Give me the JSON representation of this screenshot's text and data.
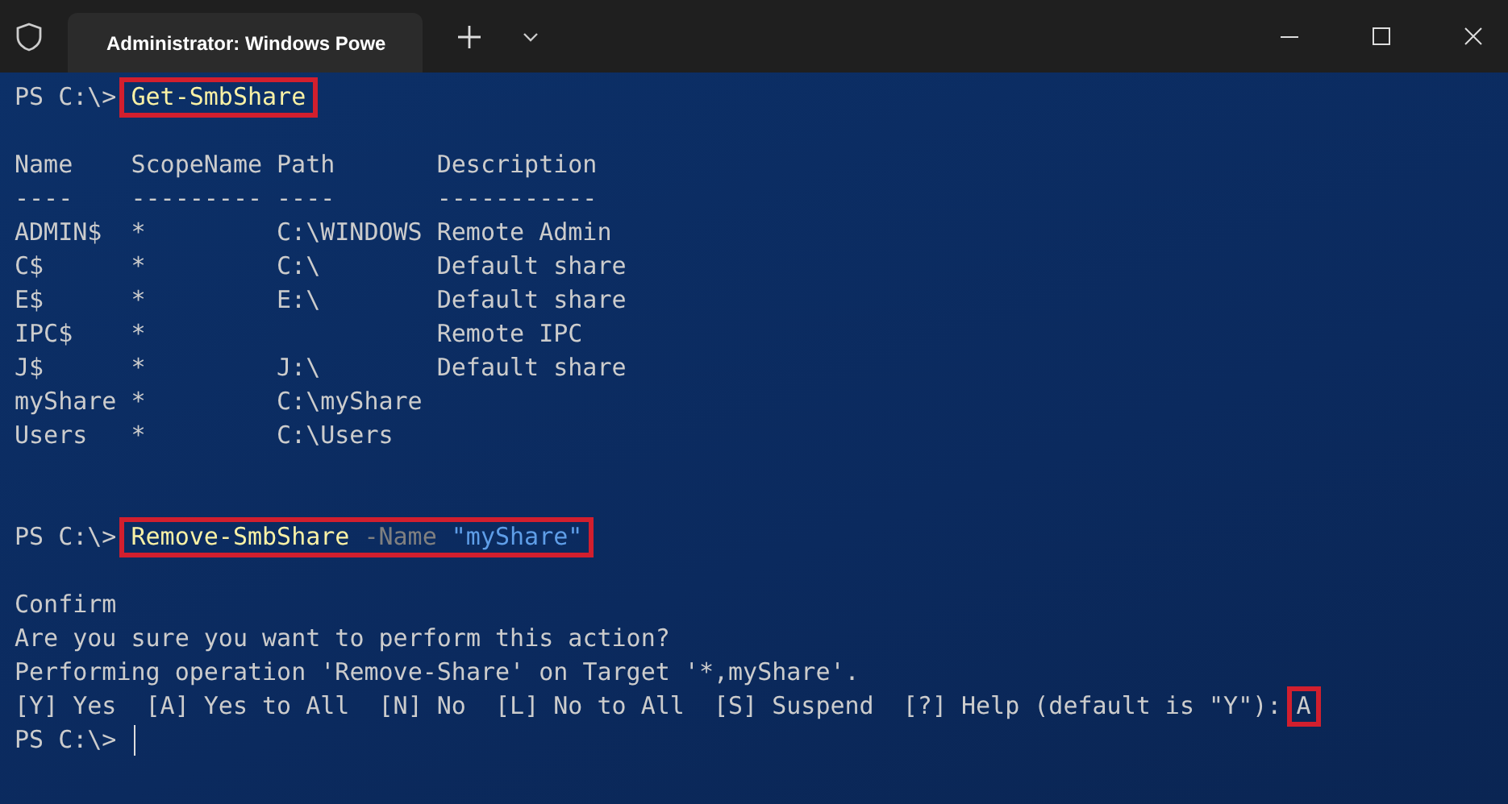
{
  "window": {
    "tab_title": "Administrator: Windows Powe"
  },
  "lines": [
    {
      "kind": "prompt",
      "prompt": "PS C:\\>",
      "segments": [
        {
          "text": "Get-SmbShare",
          "kind": "command"
        }
      ],
      "highlighted": true
    },
    {
      "kind": "blank"
    },
    {
      "kind": "table",
      "columns": [
        "Name",
        "ScopeName",
        "Path",
        "Description"
      ],
      "rules": [
        "----",
        "---------",
        "----",
        "-----------"
      ],
      "rows": [
        [
          "ADMIN$",
          "*",
          "C:\\WINDOWS",
          "Remote Admin"
        ],
        [
          "C$",
          "*",
          "C:\\",
          "Default share"
        ],
        [
          "E$",
          "*",
          "E:\\",
          "Default share"
        ],
        [
          "IPC$",
          "*",
          "",
          "Remote IPC"
        ],
        [
          "J$",
          "*",
          "J:\\",
          "Default share"
        ],
        [
          "myShare",
          "*",
          "C:\\myShare",
          ""
        ],
        [
          "Users",
          "*",
          "C:\\Users",
          ""
        ]
      ]
    },
    {
      "kind": "blank"
    },
    {
      "kind": "blank"
    },
    {
      "kind": "prompt",
      "prompt": "PS C:\\>",
      "segments": [
        {
          "text": "Remove-SmbShare",
          "kind": "command"
        },
        {
          "text": "-Name",
          "kind": "parameter"
        },
        {
          "text": "\"myShare\"",
          "kind": "string"
        }
      ],
      "highlighted": true
    },
    {
      "kind": "blank"
    },
    {
      "kind": "text",
      "text": "Confirm"
    },
    {
      "kind": "text",
      "text": "Are you sure you want to perform this action?"
    },
    {
      "kind": "text",
      "text": "Performing operation 'Remove-Share' on Target '*,myShare'."
    },
    {
      "kind": "choice",
      "text": "[Y] Yes  [A] Yes to All  [N] No  [L] No to All  [S] Suspend  [?] Help (default is \"Y\"):",
      "answer": "A",
      "highlighted": true
    },
    {
      "kind": "cursor",
      "prompt": "PS C:\\>"
    }
  ]
}
